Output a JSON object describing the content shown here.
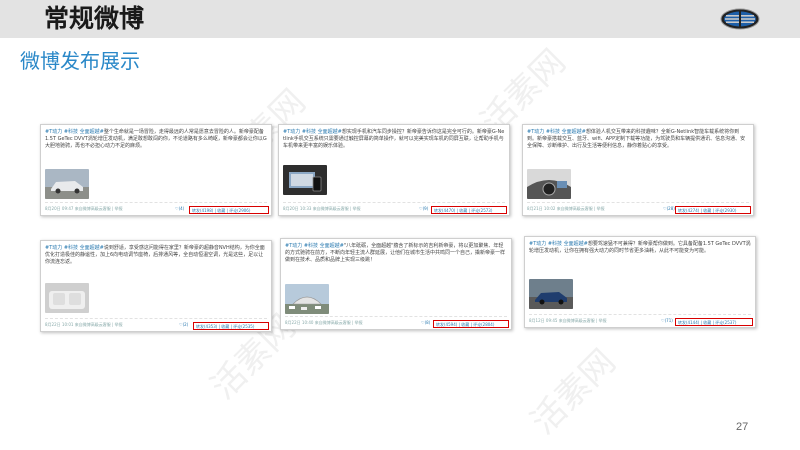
{
  "header": {
    "title": "常规微博"
  },
  "section_title": "微博发布展示",
  "page_number": "27",
  "watermark": "活素网",
  "posts": [
    {
      "tag": "#T动力 #科技 全面超越#",
      "text": "整个生命就是一场冒险，走得最远的人常是愿意去冒险的人。新帝豪配备1.5T GeTec DVVT涡轮增压发动机，满足敢想敢闯的你，不论道路有多么崎岖，新帝豪都会让你以G大胆地驰骋，再也不必担心动力不足的麻烦。",
      "time": "8月20日 09:47",
      "source": "来自微博高级云客服",
      "manage": "举报",
      "like": "(4)",
      "forward": "转发(4198)",
      "fav": "收藏",
      "comment": "评论(2906)"
    },
    {
      "tag": "#T动力 #科技 全面超越#",
      "text": "想实现手机和汽车同步操控？新帝豪告诉你这是完全可行的。新帝豪G-Netlink手机交互系统只需要通过触控屏幕的简单操作，就可以完美实现车机的同屏互联，让帮助手机与车机带来更丰富的娱乐体验。",
      "time": "8月20日 10:33",
      "source": "来自微博高级云客服",
      "manage": "举报",
      "like": "(9)",
      "forward": "转发(4470)",
      "fav": "收藏",
      "comment": "评论(2573)"
    },
    {
      "tag": "#T动力 #科技 全面超越#",
      "text": "想体验人机交互带来的科技趣味？全新G-Netlink智能车载系统将你到到。新帝豪搭载交互、蓝牙、wifi、APP定制下载等功能，为驾驶员和车辆提供通讯、信息沟通、安全保障、诊断维护、出行及生活等便利信息，静你着贴心的享受。",
      "time": "8月21日 10:02",
      "source": "来自微博高级云客服",
      "manage": "举报",
      "like": "(28)",
      "forward": "转发(4274)",
      "fav": "收藏",
      "comment": "评论(2930)"
    },
    {
      "tag": "#T动力 #科技 全面超越#",
      "text": "说到舒适，享受感这问能得在家里？新帝豪的超静音NVH结构，为你全面优化打造极佳的静谧性，加上6向电动调节座椅，后排通风等，全自动恒温空调，光是这些，足以让你流连忘返。",
      "time": "8月22日 10:01",
      "source": "来自微博高级云客服",
      "manage": "举报",
      "like": "(2)",
      "forward": "转发(4353)",
      "fav": "收藏",
      "comment": "评论(2535)"
    },
    {
      "tag": "#T动力 #科技 全面超越#",
      "text": "\"八年砥砺，全面超越\"蕴含了新标示的吉利新帝豪，将以更加聚焦、年轻的方式驰骋在前方，不断向年轻主流人群延展，让他们在城市生活中共鸣同一个自己，撬新帝豪一样做到在技术、品质和品牌上实现三级跳！",
      "time": "8月22日 10:40",
      "source": "来自微博高级云客服",
      "manage": "举报",
      "like": "(8)",
      "forward": "转发(4594)",
      "fav": "收藏",
      "comment": "评论(2804)"
    },
    {
      "tag": "#T动力 #科技 全面超越#",
      "text": "想要驾速猛不可兼得？新帝豪帮你做到。它具备配备1.5T GeTec DVVT涡轮增压发动机，让你在拥有强大动力的同时节省更多油耗，从此不可能变为可能。",
      "time": "8月12日 09:45",
      "source": "来自微博高级云客服",
      "manage": "举报",
      "like": "(71)",
      "forward": "转发(4144)",
      "fav": "收藏",
      "comment": "评论(2537)"
    }
  ],
  "colors": {
    "accent": "#2a88c8",
    "highlight": "#d80000",
    "header_bg": "#e3e3e3"
  }
}
